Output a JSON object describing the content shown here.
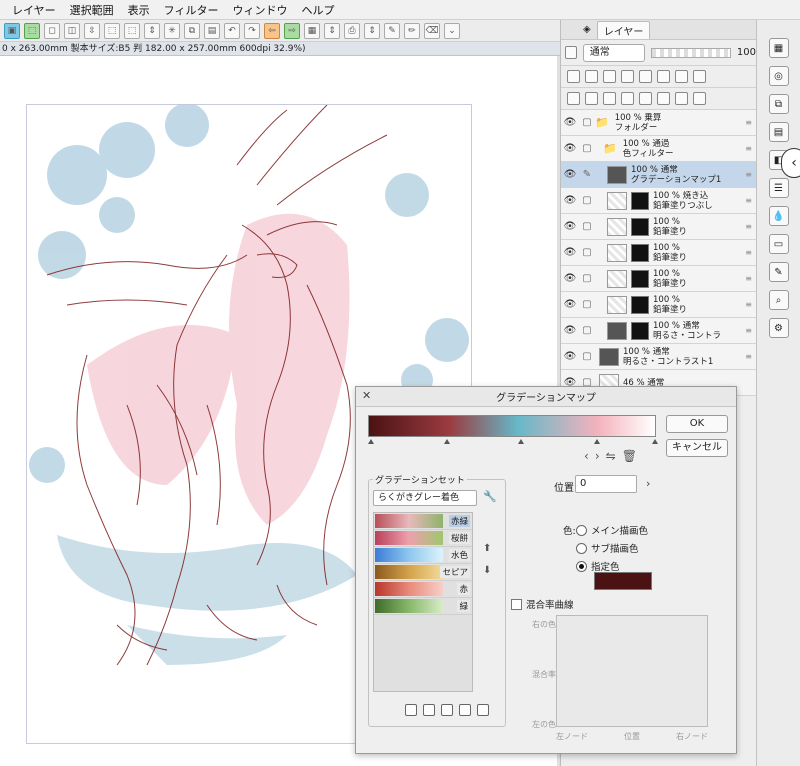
{
  "menu": [
    "レイヤー",
    "選択範囲",
    "表示",
    "フィルター",
    "ウィンドウ",
    "ヘルプ"
  ],
  "status_text": "0 x 263.00mm 製本サイズ:B5 判 182.00 x 257.00mm 600dpi 32.9%)",
  "layer_panel": {
    "tab": "レイヤー",
    "blend_mode": "通常",
    "opacity": "100",
    "layers": [
      {
        "line1": "100 % 乗算",
        "line2": "フォルダー"
      },
      {
        "line1": "100 % 通過",
        "line2": "色フィルター"
      },
      {
        "line1": "100 % 通常",
        "line2": "グラデーションマップ1"
      },
      {
        "line1": "100 % 焼き込",
        "line2": "鉛筆塗りつぶし"
      },
      {
        "line1": "100 %",
        "line2": "鉛筆塗り"
      },
      {
        "line1": "100 %",
        "line2": "鉛筆塗り"
      },
      {
        "line1": "100 %",
        "line2": "鉛筆塗り"
      },
      {
        "line1": "100 %",
        "line2": "鉛筆塗り"
      },
      {
        "line1": "100 % 通常",
        "line2": "明るさ・コントラ"
      },
      {
        "line1": "100 % 通常",
        "line2": "明るさ・コントラスト1"
      },
      {
        "line1": "46 % 通常",
        "line2": ""
      }
    ]
  },
  "dialog": {
    "title": "グラデーションマップ",
    "ok": "OK",
    "cancel": "キャンセル",
    "gradient_set_label": "グラデーションセット",
    "set_select": "らくがきグレー着色",
    "sets": [
      {
        "name": "赤緑",
        "colors": [
          "#b7505a",
          "#e8b9bb",
          "#8fb36a"
        ]
      },
      {
        "name": "桜餅",
        "colors": [
          "#b9415b",
          "#eea0ad",
          "#9ec76d"
        ]
      },
      {
        "name": "水色",
        "colors": [
          "#3c7cd6",
          "#8dc7ef",
          "#dff3fb"
        ]
      },
      {
        "name": "セピア",
        "colors": [
          "#8a5a1e",
          "#d4a24a",
          "#f2dc9c"
        ]
      },
      {
        "name": "赤",
        "colors": [
          "#b7372b",
          "#e88a7a",
          "#f7cfc8"
        ]
      },
      {
        "name": "緑",
        "colors": [
          "#3f6b2a",
          "#87b86a",
          "#d8ecc8"
        ]
      }
    ],
    "position_label": "位置:",
    "position_value": "0",
    "color_label": "色:",
    "radio_main": "メイン描画色",
    "radio_sub": "サブ描画色",
    "radio_spec": "指定色",
    "specified_color": "#4a1212",
    "curve_checkbox": "混合率曲線",
    "curve_right": "右の色",
    "curve_mix": "混合率",
    "curve_left": "左の色",
    "curve_left_node": "左ノード",
    "curve_pos": "位置",
    "curve_right_node": "右ノード"
  }
}
